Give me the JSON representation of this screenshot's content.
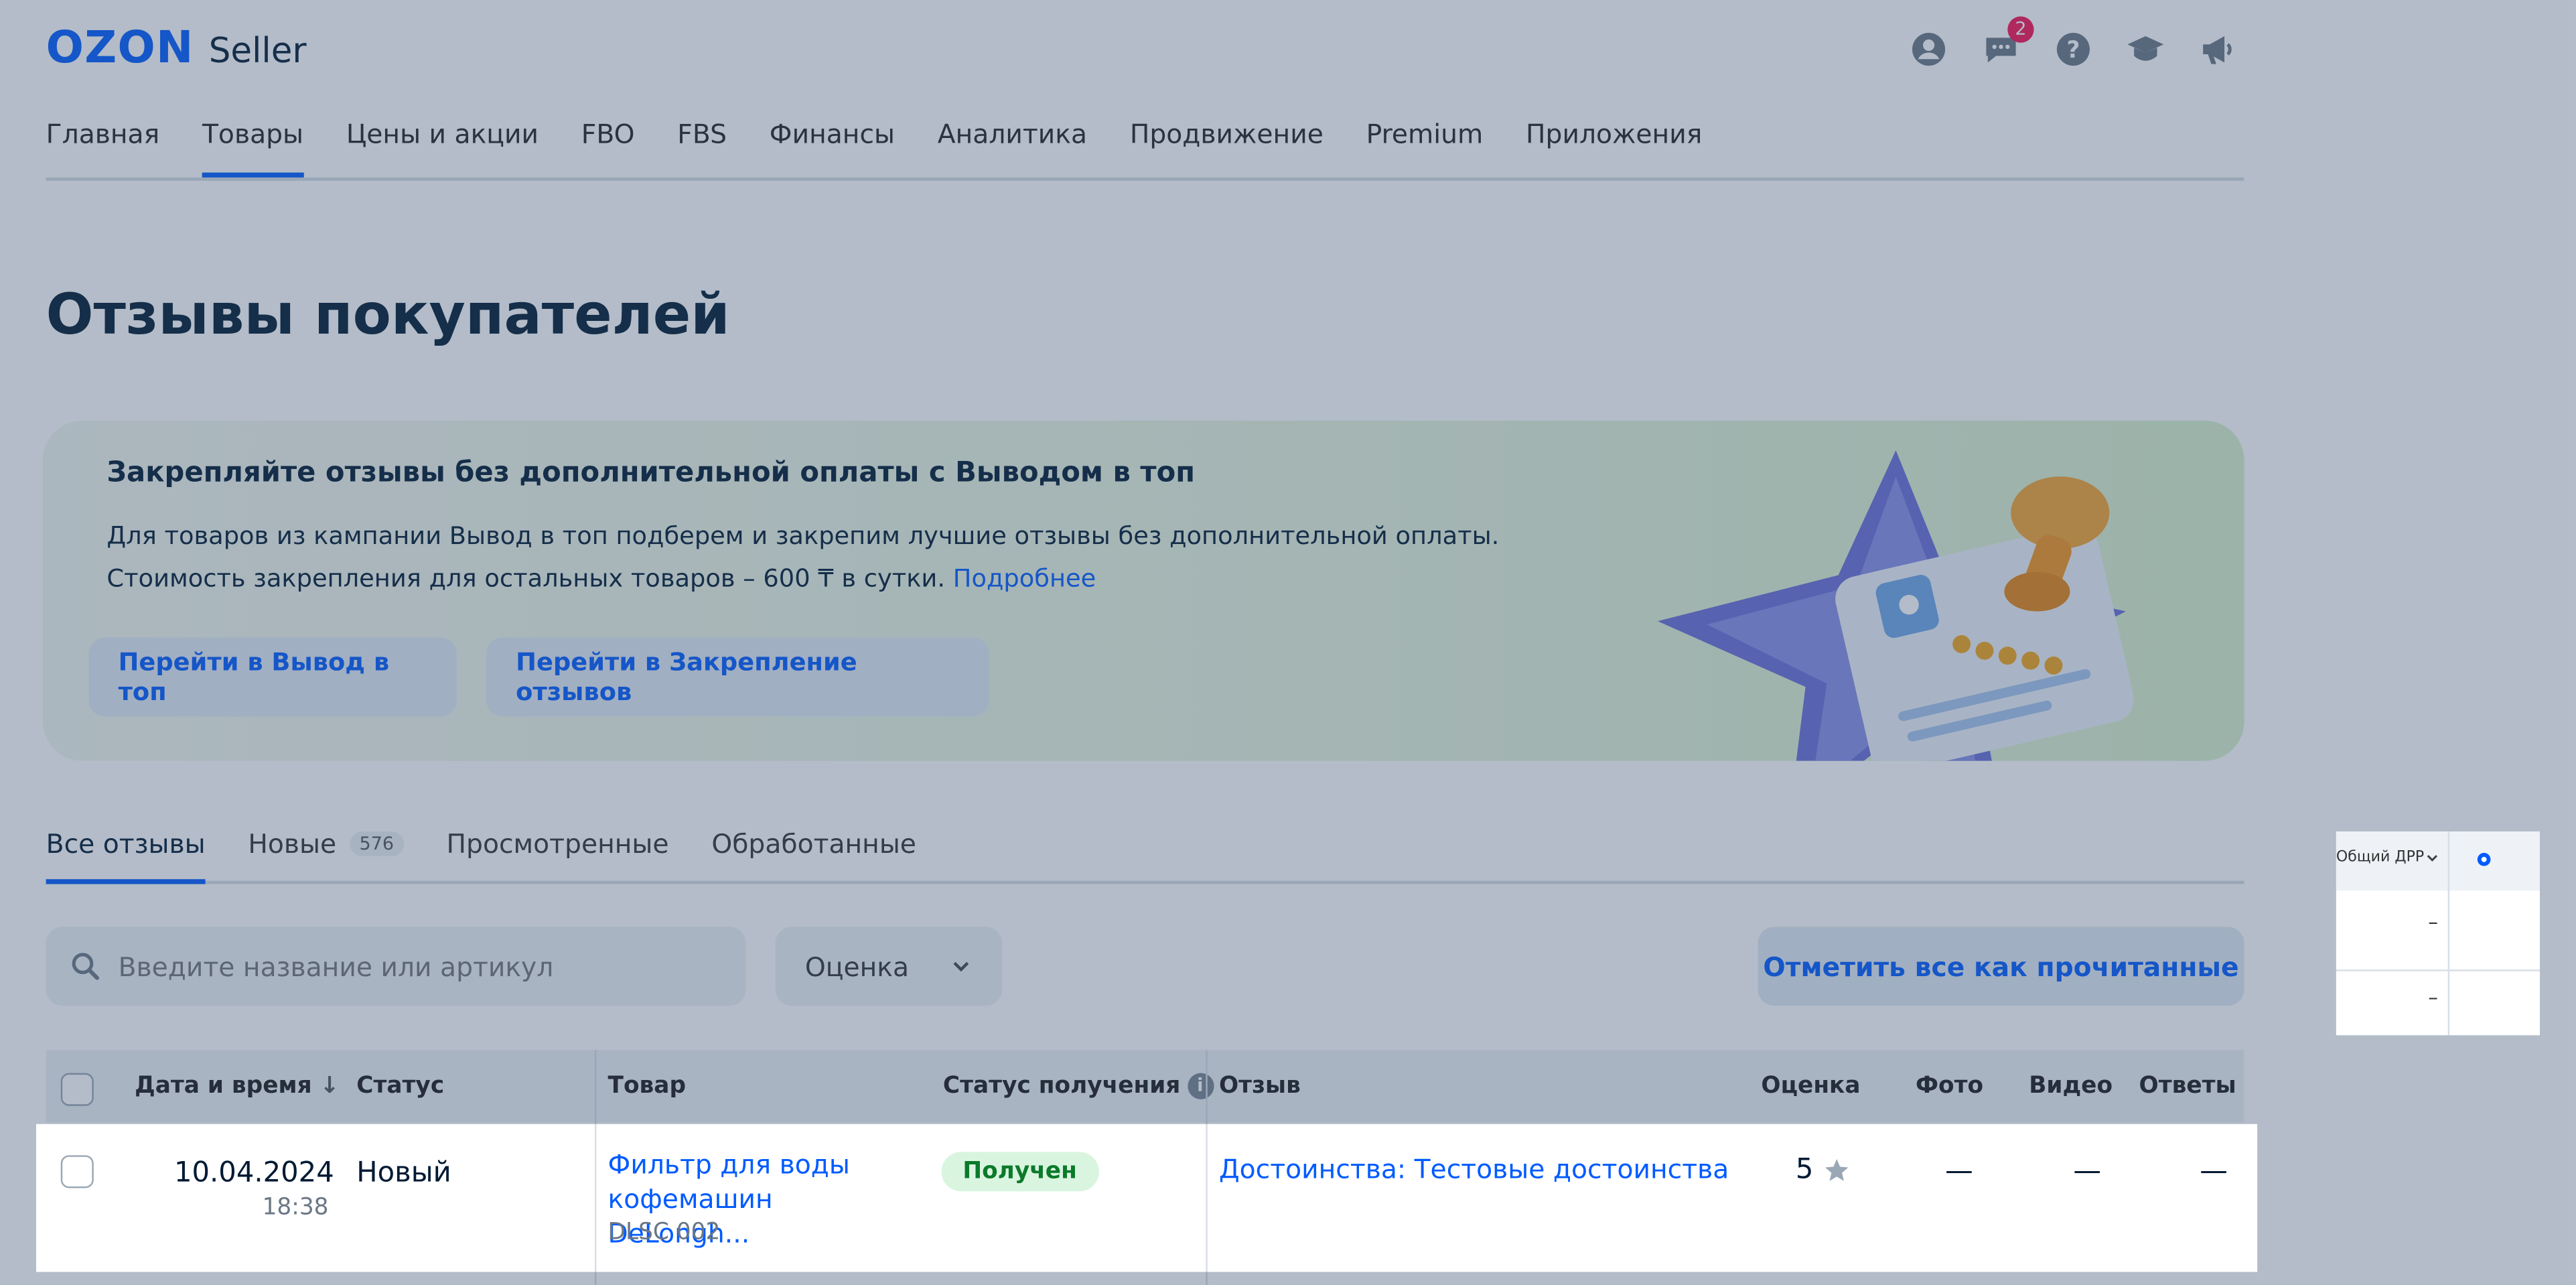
{
  "header": {
    "logo": "OZON",
    "logo_sub": "Seller",
    "icons": [
      "profile-icon",
      "chat-icon",
      "help-icon",
      "education-icon",
      "megaphone-icon"
    ],
    "chat_badge": "2"
  },
  "nav": {
    "items": [
      "Главная",
      "Товары",
      "Цены и акции",
      "FBO",
      "FBS",
      "Финансы",
      "Аналитика",
      "Продвижение",
      "Premium",
      "Приложения"
    ],
    "active": "Товары"
  },
  "page_title": "Отзывы покупателей",
  "banner": {
    "heading": "Закрепляйте отзывы без дополнительной оплаты с Выводом в топ",
    "line1": "Для товаров из кампании Вывод в топ подберем и закрепим лучшие отзывы без дополнительной оплаты.",
    "line2": "Стоимость закрепления для остальных товаров – 600 ₸ в сутки.",
    "link": "Подробнее",
    "button1": "Перейти в Вывод в топ",
    "button2": "Перейти в Закрепление отзывов"
  },
  "tabs": {
    "items": [
      "Все отзывы",
      "Новые",
      "Просмотренные",
      "Обработанные"
    ],
    "new_count": "576",
    "active": "Все отзывы"
  },
  "filters": {
    "search_placeholder": "Введите название или артикул",
    "rating_select": "Оценка",
    "mark_all": "Отметить все как прочитанные"
  },
  "table": {
    "columns": {
      "date": "Дата и время",
      "status": "Статус",
      "product": "Товар",
      "receipt_status": "Статус получения",
      "review": "Отзыв",
      "rating": "Оценка",
      "photo": "Фото",
      "video": "Видео",
      "answers": "Ответы"
    },
    "rows": [
      {
        "date": "10.04.2024",
        "time": "18:38",
        "status": "Новый",
        "product": "Фильтр для воды кофемашин DeLongh...",
        "sku": "DLSC 002",
        "receipt": "Получен",
        "review": "Достоинства: Тестовые достоинства",
        "rating": "5",
        "photo": "—",
        "video": "—",
        "answers": "—"
      }
    ]
  },
  "side_panel": {
    "header": "Общий ДРР",
    "dash1": "–",
    "dash2": "–"
  },
  "colors": {
    "brand": "#005bff",
    "overlay": "#37506e",
    "received_bg": "#d9f5df",
    "received_text": "#0b7a2a",
    "badge": "#f91155"
  }
}
